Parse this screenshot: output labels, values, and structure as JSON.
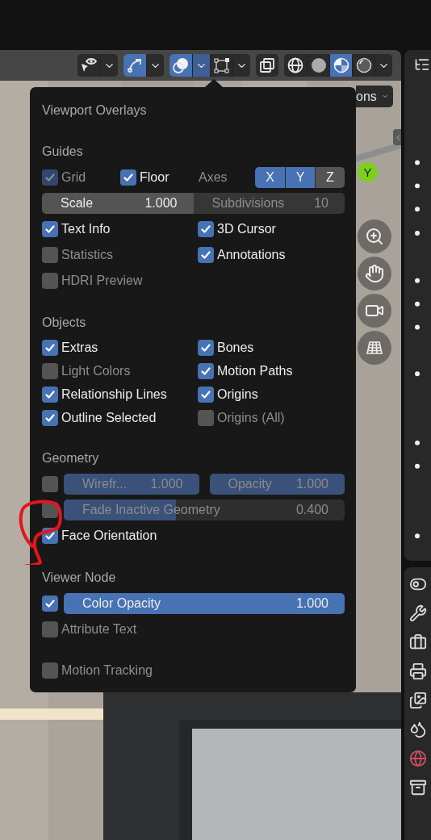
{
  "header": {
    "groups": [
      {
        "items": [
          {
            "kind": "visibility",
            "selected": false
          },
          {
            "kind": "chevron",
            "selected": false
          }
        ]
      },
      {
        "items": [
          {
            "kind": "gizmo",
            "selected": true
          },
          {
            "kind": "chevron",
            "selected": false
          }
        ]
      },
      {
        "items": [
          {
            "kind": "overlays",
            "selected": true
          },
          {
            "kind": "chevron",
            "selected": true
          },
          {
            "kind": "mesh",
            "selected": false
          },
          {
            "kind": "chevron",
            "selected": false
          }
        ]
      },
      {
        "items": [
          {
            "kind": "xray",
            "selected": false
          }
        ]
      },
      {
        "items": [
          {
            "kind": "wire",
            "selected": false
          },
          {
            "kind": "solid",
            "selected": false
          },
          {
            "kind": "material",
            "selected": true
          },
          {
            "kind": "rendered",
            "selected": false
          },
          {
            "kind": "chevron",
            "selected": false
          }
        ]
      }
    ]
  },
  "viewport": {
    "dropdown_text": "ons",
    "gizmo_axis": "Y"
  },
  "popup": {
    "title": "Viewport Overlays",
    "sections": [
      {
        "heading": "Guides",
        "rows": [
          {
            "kind": "grid_axes",
            "checks": [
              {
                "label": "Grid",
                "checked": true,
                "disabled": true
              },
              {
                "label": "Floor",
                "checked": true,
                "disabled": false
              }
            ],
            "axes_label": "Axes",
            "axes": [
              {
                "label": "X",
                "selected": true
              },
              {
                "label": "Y",
                "selected": true
              },
              {
                "label": "Z",
                "selected": false
              }
            ]
          },
          {
            "kind": "fields",
            "joined": true,
            "fields": [
              {
                "kind": "number",
                "label": "Scale",
                "value": "1.000",
                "disabled": false
              },
              {
                "kind": "number",
                "label": "Subdivisions",
                "value": "10",
                "disabled": true
              }
            ]
          },
          {
            "kind": "checks",
            "checks": [
              {
                "label": "Text Info",
                "checked": true,
                "disabled": false
              },
              {
                "label": "3D Cursor",
                "checked": true,
                "disabled": false
              }
            ]
          },
          {
            "kind": "checks",
            "checks": [
              {
                "label": "Statistics",
                "checked": false,
                "disabled": false
              },
              {
                "label": "Annotations",
                "checked": true,
                "disabled": false
              }
            ]
          },
          {
            "kind": "checks",
            "checks": [
              {
                "label": "HDRI Preview",
                "checked": false,
                "disabled": false
              }
            ]
          }
        ]
      },
      {
        "heading": "Objects",
        "rows": [
          {
            "kind": "checks",
            "checks": [
              {
                "label": "Extras",
                "checked": true,
                "disabled": false
              },
              {
                "label": "Bones",
                "checked": true,
                "disabled": false
              }
            ]
          },
          {
            "kind": "checks",
            "checks": [
              {
                "label": "Light Colors",
                "checked": false,
                "disabled": false
              },
              {
                "label": "Motion Paths",
                "checked": true,
                "disabled": false
              }
            ]
          },
          {
            "kind": "checks",
            "checks": [
              {
                "label": "Relationship Lines",
                "checked": true,
                "disabled": false
              },
              {
                "label": "Origins",
                "checked": true,
                "disabled": false
              }
            ]
          },
          {
            "kind": "checks",
            "checks": [
              {
                "label": "Outline Selected",
                "checked": true,
                "disabled": false
              },
              {
                "label": "Origins (All)",
                "checked": false,
                "disabled": false
              }
            ]
          }
        ]
      },
      {
        "heading": "Geometry",
        "rows": [
          {
            "kind": "fields",
            "checkbox": {
              "checked": false
            },
            "fields": [
              {
                "kind": "slider",
                "label": "Wirefr...",
                "value": "1.000",
                "level": 1,
                "disabled": true
              },
              {
                "kind": "slider",
                "label": "Opacity",
                "value": "1.000",
                "level": 1,
                "disabled": true
              }
            ]
          },
          {
            "kind": "fields",
            "checkbox": {
              "checked": false
            },
            "fields": [
              {
                "kind": "slider",
                "label": "Fade Inactive Geometry",
                "value": "0.400",
                "level": 0.4,
                "disabled": true
              }
            ]
          },
          {
            "kind": "checks",
            "checks": [
              {
                "label": "Face Orientation",
                "checked": true,
                "disabled": false
              }
            ]
          }
        ]
      },
      {
        "heading": "Viewer Node",
        "rows": [
          {
            "kind": "fields",
            "checkbox": {
              "checked": true
            },
            "fields": [
              {
                "kind": "slider",
                "label": "Color Opacity",
                "value": "1.000",
                "level": 1,
                "disabled": false
              }
            ]
          },
          {
            "kind": "checks",
            "checks": [
              {
                "label": "Attribute Text",
                "checked": false,
                "disabled": false
              }
            ]
          }
        ]
      },
      {
        "rows": [
          {
            "kind": "checks",
            "checks": [
              {
                "label": "Motion Tracking",
                "checked": false,
                "disabled": false
              }
            ]
          }
        ]
      }
    ]
  }
}
